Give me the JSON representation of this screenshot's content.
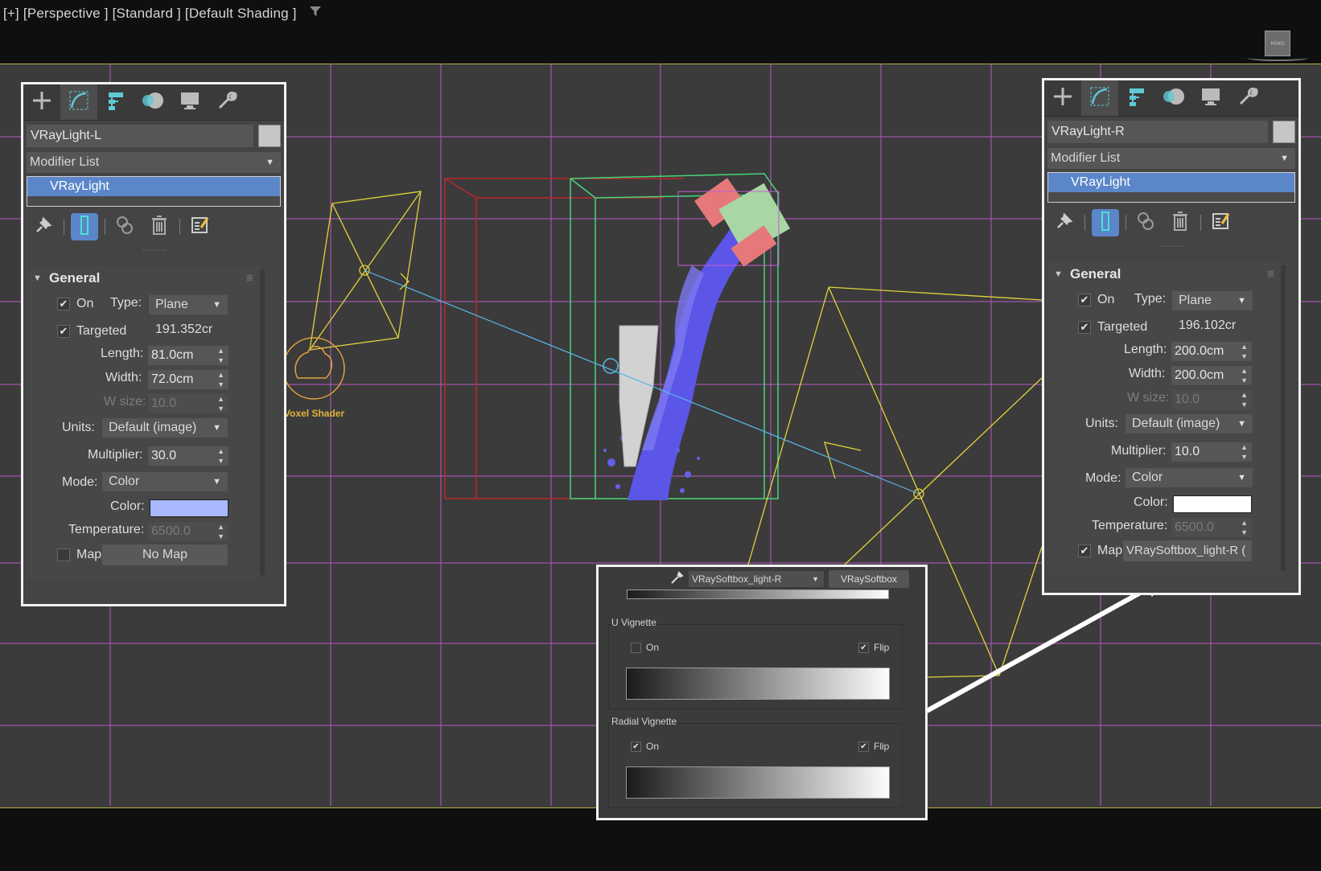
{
  "viewport": {
    "label": "[+] [Perspective ] [Standard ] [Default Shading ]",
    "filter_icon": "funnel-icon",
    "shader_label": "Voxel Shader",
    "viewcube_label": "ноко"
  },
  "tabs": [
    "create-icon",
    "modify-icon",
    "hierarchy-icon",
    "motion-icon",
    "display-icon",
    "utilities-icon"
  ],
  "left_panel": {
    "object_name": "VRayLight-L",
    "modifier_list": "Modifier List",
    "stack_item": "VRayLight",
    "rollout_title": "General",
    "on_label": "On",
    "on_checked": true,
    "type_label": "Type:",
    "type_value": "Plane",
    "targeted_label": "Targeted",
    "targeted_checked": true,
    "targeted_value": "191.352cr",
    "length_label": "Length:",
    "length_value": "81.0cm",
    "width_label": "Width:",
    "width_value": "72.0cm",
    "wsize_label": "W size:",
    "wsize_value": "10.0",
    "units_label": "Units:",
    "units_value": "Default (image)",
    "multiplier_label": "Multiplier:",
    "multiplier_value": "30.0",
    "mode_label": "Mode:",
    "mode_value": "Color",
    "color_label": "Color:",
    "color_value": "#aab9ff",
    "temperature_label": "Temperature:",
    "temperature_value": "6500.0",
    "map_label": "Map",
    "map_checked": false,
    "map_button": "No Map"
  },
  "right_panel": {
    "object_name": "VRayLight-R",
    "modifier_list": "Modifier List",
    "stack_item": "VRayLight",
    "rollout_title": "General",
    "on_label": "On",
    "on_checked": true,
    "type_label": "Type:",
    "type_value": "Plane",
    "targeted_label": "Targeted",
    "targeted_checked": true,
    "targeted_value": "196.102cr",
    "length_label": "Length:",
    "length_value": "200.0cm",
    "width_label": "Width:",
    "width_value": "200.0cm",
    "wsize_label": "W size:",
    "wsize_value": "10.0",
    "units_label": "Units:",
    "units_value": "Default (image)",
    "multiplier_label": "Multiplier:",
    "multiplier_value": "10.0",
    "mode_label": "Mode:",
    "mode_value": "Color",
    "color_label": "Color:",
    "color_value": "#ffffff",
    "temperature_label": "Temperature:",
    "temperature_value": "6500.0",
    "map_label": "Map",
    "map_checked": true,
    "map_button": "VRaySoftbox_light-R  ("
  },
  "map_editor": {
    "map_name": "VRaySoftbox_light-R",
    "map_type": "VRaySoftbox",
    "u_vignette_title": "U Vignette",
    "u_on_label": "On",
    "u_on_checked": false,
    "u_flip_label": "Flip",
    "u_flip_checked": true,
    "radial_title": "Radial Vignette",
    "r_on_label": "On",
    "r_on_checked": true,
    "r_flip_label": "Flip",
    "r_flip_checked": true
  },
  "colors": {
    "accent": "#5b86c9",
    "grid": "#c65ed6",
    "light_gizmo": "#e2d23c",
    "target_line": "#59b7e8",
    "fluid": "#5b55e8"
  }
}
